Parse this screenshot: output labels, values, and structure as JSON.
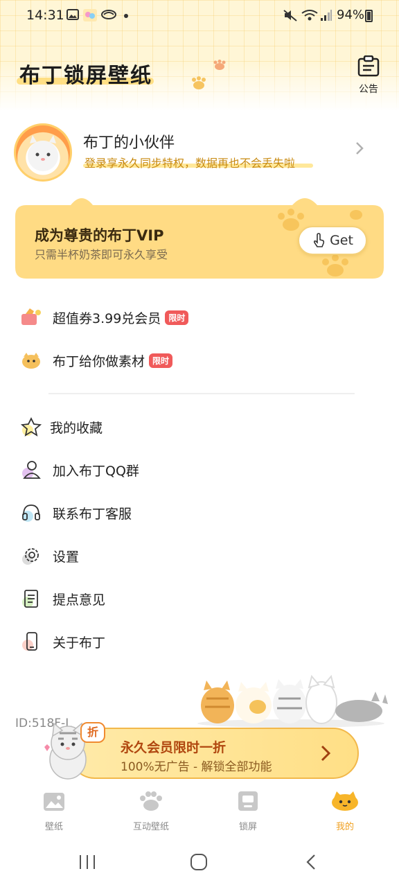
{
  "status_bar": {
    "time": "14:31",
    "battery": "94%"
  },
  "header": {
    "title": "布丁锁屏壁纸",
    "notice_label": "公告"
  },
  "profile": {
    "name": "布丁的小伙伴",
    "subtitle": "登录享永久同步特权，数据再也不会丢失啦"
  },
  "vip_card": {
    "title": "成为尊贵的布丁VIP",
    "subtitle": "只需半杯奶茶即可永久享受",
    "button_label": "Get"
  },
  "promos": [
    {
      "label": "超值券3.99兑会员",
      "badge": "限时",
      "icon": "coupon-icon"
    },
    {
      "label": "布丁给你做素材",
      "badge": "限时",
      "icon": "pudding-face-icon"
    }
  ],
  "menu": [
    {
      "label": "我的收藏",
      "icon": "star-icon"
    },
    {
      "label": "加入布丁QQ群",
      "icon": "group-user-icon"
    },
    {
      "label": "联系布丁客服",
      "icon": "headset-icon"
    },
    {
      "label": "设置",
      "icon": "gear-icon"
    },
    {
      "label": "提点意见",
      "icon": "feedback-doc-icon"
    },
    {
      "label": "关于布丁",
      "icon": "phone-info-icon"
    }
  ],
  "user_id": "ID:518F-L",
  "promo_bar": {
    "tag": "折",
    "title": "永久会员限时一折",
    "subtitle": "100%无广告 - 解锁全部功能"
  },
  "tabs": [
    {
      "label": "壁纸",
      "icon": "image-icon",
      "active": false
    },
    {
      "label": "互动壁纸",
      "icon": "paw-icon",
      "active": false
    },
    {
      "label": "锁屏",
      "icon": "lockscreen-icon",
      "active": false
    },
    {
      "label": "我的",
      "icon": "pudding-cat-icon",
      "active": true
    }
  ],
  "colors": {
    "accent": "#f0a020",
    "vip_card": "#ffdb84",
    "badge": "#f05a5a",
    "header_bg": "#fff6d6"
  }
}
